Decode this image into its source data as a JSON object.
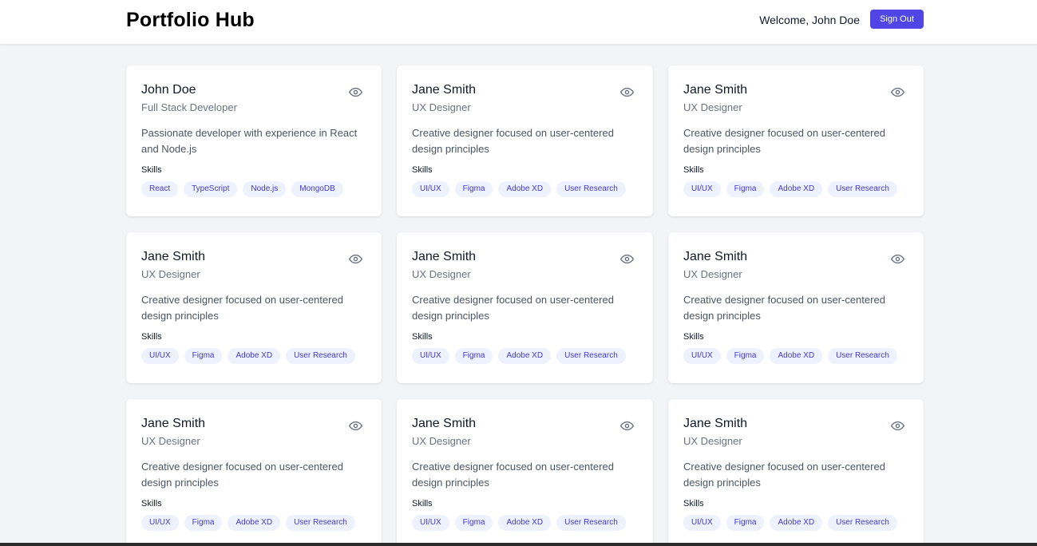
{
  "header": {
    "brand": "Portfolio Hub",
    "welcome": "Welcome, John Doe",
    "sign_out_label": "Sign Out"
  },
  "colors": {
    "accent": "#4f46e5",
    "tag_bg": "#eef2ff",
    "tag_text": "#4338ca",
    "page_bg": "#f3f4f6"
  },
  "profiles": [
    {
      "name": "John Doe",
      "title": "Full Stack Developer",
      "bio": "Passionate developer with experience in React and Node.js",
      "skills_label": "Skills",
      "skills": [
        "React",
        "TypeScript",
        "Node.js",
        "MongoDB"
      ],
      "icon": "eye-icon"
    },
    {
      "name": "Jane Smith",
      "title": "UX Designer",
      "bio": "Creative designer focused on user-centered design principles",
      "skills_label": "Skills",
      "skills": [
        "UI/UX",
        "Figma",
        "Adobe XD",
        "User Research"
      ],
      "icon": "eye-icon"
    },
    {
      "name": "Jane Smith",
      "title": "UX Designer",
      "bio": "Creative designer focused on user-centered design principles",
      "skills_label": "Skills",
      "skills": [
        "UI/UX",
        "Figma",
        "Adobe XD",
        "User Research"
      ],
      "icon": "eye-icon"
    },
    {
      "name": "Jane Smith",
      "title": "UX Designer",
      "bio": "Creative designer focused on user-centered design principles",
      "skills_label": "Skills",
      "skills": [
        "UI/UX",
        "Figma",
        "Adobe XD",
        "User Research"
      ],
      "icon": "eye-icon"
    },
    {
      "name": "Jane Smith",
      "title": "UX Designer",
      "bio": "Creative designer focused on user-centered design principles",
      "skills_label": "Skills",
      "skills": [
        "UI/UX",
        "Figma",
        "Adobe XD",
        "User Research"
      ],
      "icon": "eye-icon"
    },
    {
      "name": "Jane Smith",
      "title": "UX Designer",
      "bio": "Creative designer focused on user-centered design principles",
      "skills_label": "Skills",
      "skills": [
        "UI/UX",
        "Figma",
        "Adobe XD",
        "User Research"
      ],
      "icon": "eye-icon"
    },
    {
      "name": "Jane Smith",
      "title": "UX Designer",
      "bio": "Creative designer focused on user-centered design principles",
      "skills_label": "Skills",
      "skills": [
        "UI/UX",
        "Figma",
        "Adobe XD",
        "User Research"
      ],
      "icon": "eye-icon"
    },
    {
      "name": "Jane Smith",
      "title": "UX Designer",
      "bio": "Creative designer focused on user-centered design principles",
      "skills_label": "Skills",
      "skills": [
        "UI/UX",
        "Figma",
        "Adobe XD",
        "User Research"
      ],
      "icon": "eye-icon"
    },
    {
      "name": "Jane Smith",
      "title": "UX Designer",
      "bio": "Creative designer focused on user-centered design principles",
      "skills_label": "Skills",
      "skills": [
        "UI/UX",
        "Figma",
        "Adobe XD",
        "User Research"
      ],
      "icon": "eye-icon"
    }
  ]
}
